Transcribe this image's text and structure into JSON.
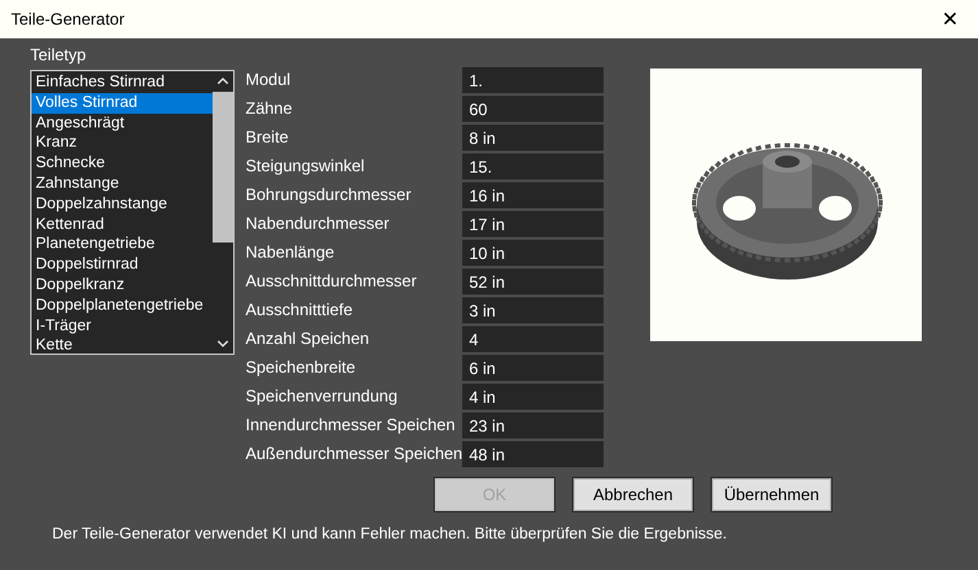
{
  "window": {
    "title": "Teile-Generator",
    "close": "✕"
  },
  "part_type": {
    "label": "Teiletyp",
    "items": [
      {
        "label": "Einfaches Stirnrad",
        "selected": false
      },
      {
        "label": "Volles Stirnrad",
        "selected": true
      },
      {
        "label": "Angeschrägt",
        "selected": false
      },
      {
        "label": "Kranz",
        "selected": false
      },
      {
        "label": "Schnecke",
        "selected": false
      },
      {
        "label": "Zahnstange",
        "selected": false
      },
      {
        "label": "Doppelzahnstange",
        "selected": false
      },
      {
        "label": "Kettenrad",
        "selected": false
      },
      {
        "label": "Planetengetriebe",
        "selected": false
      },
      {
        "label": "Doppelstirnrad",
        "selected": false
      },
      {
        "label": "Doppelkranz",
        "selected": false
      },
      {
        "label": "Doppelplanetengetriebe",
        "selected": false
      },
      {
        "label": "I-Träger",
        "selected": false
      },
      {
        "label": "Kette",
        "selected": false
      }
    ]
  },
  "parameters": [
    {
      "label": "Modul",
      "value": "1."
    },
    {
      "label": "Zähne",
      "value": "60"
    },
    {
      "label": "Breite",
      "value": "8 in"
    },
    {
      "label": "Steigungswinkel",
      "value": "15."
    },
    {
      "label": "Bohrungsdurchmesser",
      "value": "16 in"
    },
    {
      "label": "Nabendurchmesser",
      "value": "17 in"
    },
    {
      "label": "Nabenlänge",
      "value": "10 in"
    },
    {
      "label": "Ausschnittdurchmesser",
      "value": "52 in"
    },
    {
      "label": "Ausschnitttiefe",
      "value": "3 in"
    },
    {
      "label": "Anzahl Speichen",
      "value": "4"
    },
    {
      "label": "Speichenbreite",
      "value": "6 in"
    },
    {
      "label": "Speichenverrundung",
      "value": "4 in"
    },
    {
      "label": "Innendurchmesser Speichen",
      "value": "23 in"
    },
    {
      "label": "Außendurchmesser Speichen",
      "value": "48 in"
    }
  ],
  "buttons": [
    {
      "label": "OK",
      "disabled": true
    },
    {
      "label": "Abbrechen",
      "disabled": false
    },
    {
      "label": "Übernehmen",
      "disabled": false
    }
  ],
  "disclaimer": "Der Teile-Generator verwendet KI und kann Fehler machen. Bitte überprüfen Sie die Ergebnisse."
}
